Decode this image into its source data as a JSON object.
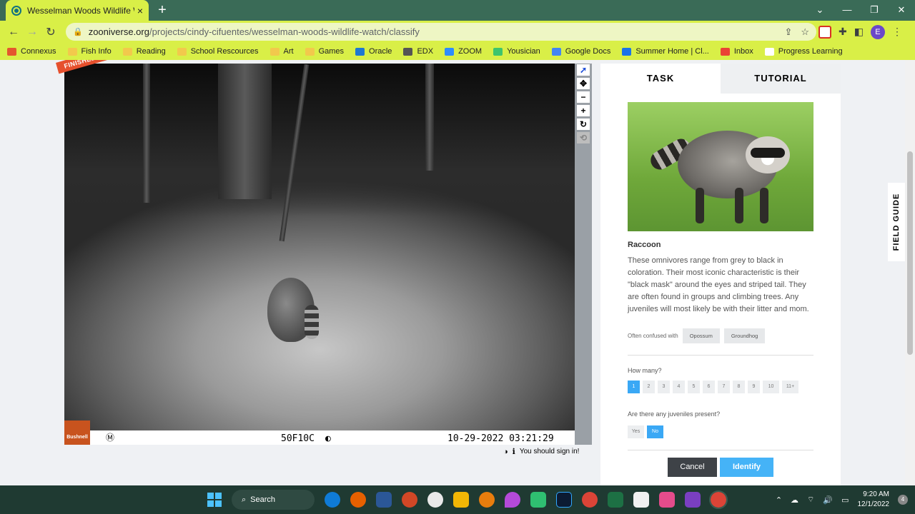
{
  "browser": {
    "tab_title": "Wesselman Woods Wildlife Watch",
    "tab_close": "×",
    "new_tab": "+",
    "url_host": "zooniverse.org",
    "url_path": "/projects/cindy-cifuentes/wesselman-woods-wildlife-watch/classify",
    "profile_initial": "E",
    "window_controls": [
      "⌄",
      "—",
      "❐",
      "✕"
    ]
  },
  "bookmarks": [
    {
      "label": "Connexus",
      "icon": "connexus-icon",
      "color": "#e4572e"
    },
    {
      "label": "Fish Info",
      "icon": "folder-icon",
      "color": "#f2c94c"
    },
    {
      "label": "Reading",
      "icon": "folder-icon",
      "color": "#f2c94c"
    },
    {
      "label": "School Rescources",
      "icon": "folder-icon",
      "color": "#f2c94c"
    },
    {
      "label": "Art",
      "icon": "folder-icon",
      "color": "#f2c94c"
    },
    {
      "label": "Games",
      "icon": "folder-icon",
      "color": "#f2c94c"
    },
    {
      "label": "Oracle",
      "icon": "cloud-icon",
      "color": "#1f78d1"
    },
    {
      "label": "EDX",
      "icon": "edx-icon",
      "color": "#555555"
    },
    {
      "label": "ZOOM",
      "icon": "zoom-icon",
      "color": "#2d8cff"
    },
    {
      "label": "Yousician",
      "icon": "yousician-icon",
      "color": "#3ec46d"
    },
    {
      "label": "Google Docs",
      "icon": "docs-icon",
      "color": "#4285f4"
    },
    {
      "label": "Summer Home | Cl...",
      "icon": "summer-icon",
      "color": "#1a73e8"
    },
    {
      "label": "Inbox",
      "icon": "gmail-icon",
      "color": "#ea4335"
    },
    {
      "label": "Progress Learning",
      "icon": "progress-icon",
      "color": "#ffffff"
    }
  ],
  "subject": {
    "badge": "FINISHED!",
    "brand": "Bushnell",
    "temperature": "50F10C",
    "timestamp": "10-29-2022 03:21:29"
  },
  "viewer_tools": [
    {
      "icon": "pointer-icon",
      "glyph": "➚"
    },
    {
      "icon": "move-icon",
      "glyph": "✥"
    },
    {
      "icon": "zoom-out-icon",
      "glyph": "−"
    },
    {
      "icon": "zoom-in-icon",
      "glyph": "+"
    },
    {
      "icon": "rotate-icon",
      "glyph": "↻"
    },
    {
      "icon": "reset-icon",
      "glyph": "⟲"
    }
  ],
  "signin_text": "You should sign in!",
  "panel": {
    "tabs": [
      "TASK",
      "TUTORIAL"
    ],
    "species": "Raccoon",
    "description": "These omnivores range from grey to black in coloration. Their most iconic characteristic is their \"black mask\" around the eyes and striped tail. They are often found in groups and climbing trees. Any juveniles will most likely be with their litter and mom.",
    "confused_label": "Often confused with",
    "confused_with": [
      "Opossum",
      "Groundhog"
    ],
    "how_many_label": "How many?",
    "counts": [
      "1",
      "2",
      "3",
      "4",
      "5",
      "6",
      "7",
      "8",
      "9",
      "10",
      "11+"
    ],
    "selected_count": "1",
    "juveniles_label": "Are there any juveniles present?",
    "juvenile_options": [
      "Yes",
      "No"
    ],
    "selected_juvenile": "No",
    "cancel_label": "Cancel",
    "identify_label": "Identify"
  },
  "field_guide_label": "FIELD GUIDE",
  "taskbar": {
    "search_label": "Search",
    "time": "9:20 AM",
    "date": "12/1/2022",
    "notifications": "4"
  }
}
